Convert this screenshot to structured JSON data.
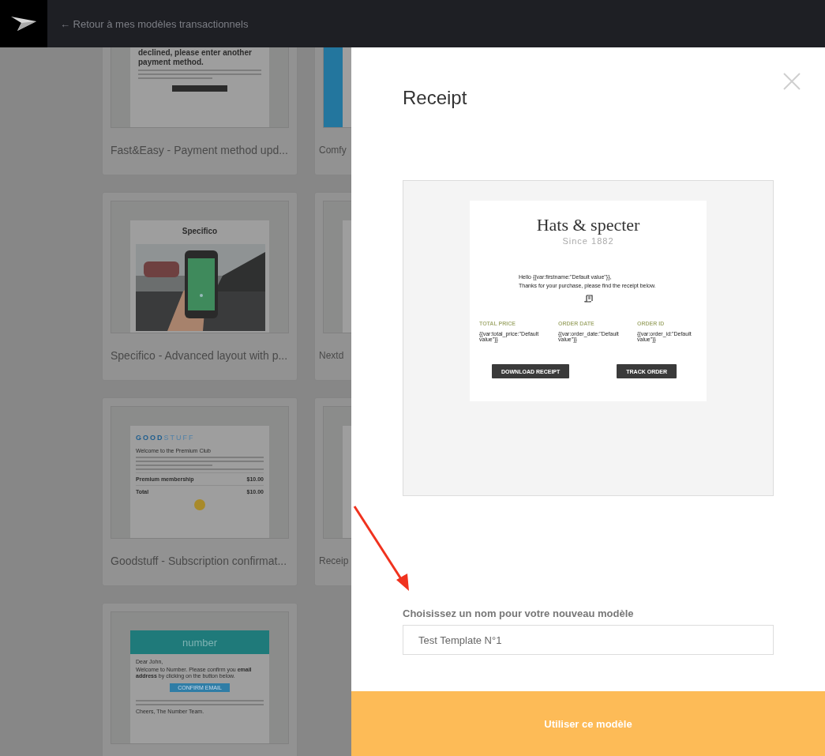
{
  "top_bar": {
    "back_link": "← Retour à mes modèles transactionnels"
  },
  "templates": [
    {
      "kind": "payment",
      "title": "Fast&Easy - Payment method upd...",
      "heading": "declined, please enter another payment method."
    },
    {
      "kind": "stripe",
      "title": "Comfy"
    },
    {
      "title": "Specifico - Advanced layout with p...",
      "brand": "Specifico"
    },
    {
      "kind": "blank",
      "title": "Nextd"
    },
    {
      "kind": "subscription",
      "title": "Goodstuff - Subscription confirmat...",
      "brand_strong": "GOOD",
      "brand_light": "STUFF",
      "heading": "Welcome to the Premium Club",
      "lines": [
        {
          "label": "Premium membership",
          "amount": "$10.00"
        },
        {
          "label": "Total",
          "amount": "$10.00"
        }
      ]
    },
    {
      "kind": "blank",
      "title": "Receip"
    },
    {
      "kind": "confirm",
      "brand": "number",
      "greeting": "Dear John,",
      "body": "Welcome to Number. Please confirm you **email address** by clicking on the button below.",
      "button": "CONFIRM EMAIL",
      "signoff": "Cheers, The Number Team."
    }
  ],
  "modal": {
    "title": "Receipt",
    "preview": {
      "brand": "Hats & specter",
      "tagline": "Since 1882",
      "greeting": "Hello {{var:firstname:\"Default value\"}},",
      "message": "Thanks for your purchase, please find the receipt below.",
      "fields": [
        {
          "label": "TOTAL PRICE",
          "value": "{{var:total_price:\"Default value\"}}"
        },
        {
          "label": "ORDER DATE",
          "value": "{{var:order_date:\"Default value\"}}"
        },
        {
          "label": "ORDER ID",
          "value": "{{var:order_id:\"Default value\"}}"
        }
      ],
      "buttons": [
        "DOWNLOAD RECEIPT",
        "TRACK ORDER"
      ]
    },
    "name_label": "Choisissez un nom pour votre nouveau modèle",
    "name_value": "Test Template N°1",
    "submit": "Utiliser ce modèle"
  }
}
